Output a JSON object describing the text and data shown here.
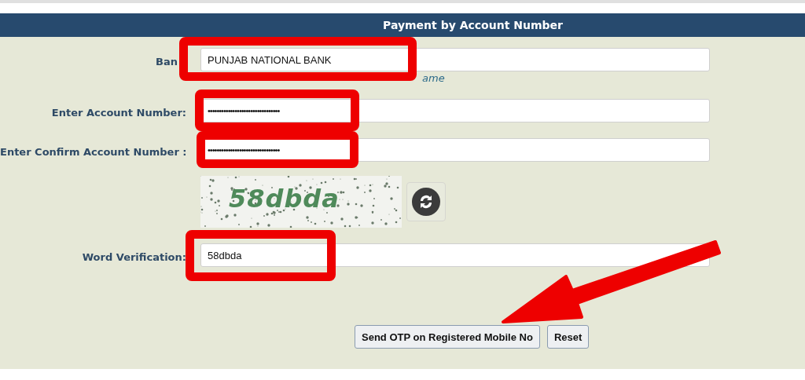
{
  "header": {
    "title": "Payment by Account Number"
  },
  "fields": [
    {
      "kind": "text",
      "label": "Ban",
      "value": "PUNJAB NATIONAL BANK",
      "hint": "ame",
      "highlighted": true
    },
    {
      "kind": "masked",
      "label": "Enter Account Number:",
      "value": "••••••••••••••••••••••••••••••••",
      "highlighted": true
    },
    {
      "kind": "masked",
      "label": "Enter Confirm Account Number :",
      "value": "••••••••••••••••••••••••••••••••",
      "highlighted": true
    },
    {
      "kind": "captcha",
      "text": "58dbda"
    },
    {
      "kind": "text",
      "label": "Word Verification:",
      "value": "58dbda",
      "highlighted": true
    }
  ],
  "buttons": [
    "Send OTP on Registered Mobile No",
    "Reset"
  ],
  "pointer_arrow": true
}
